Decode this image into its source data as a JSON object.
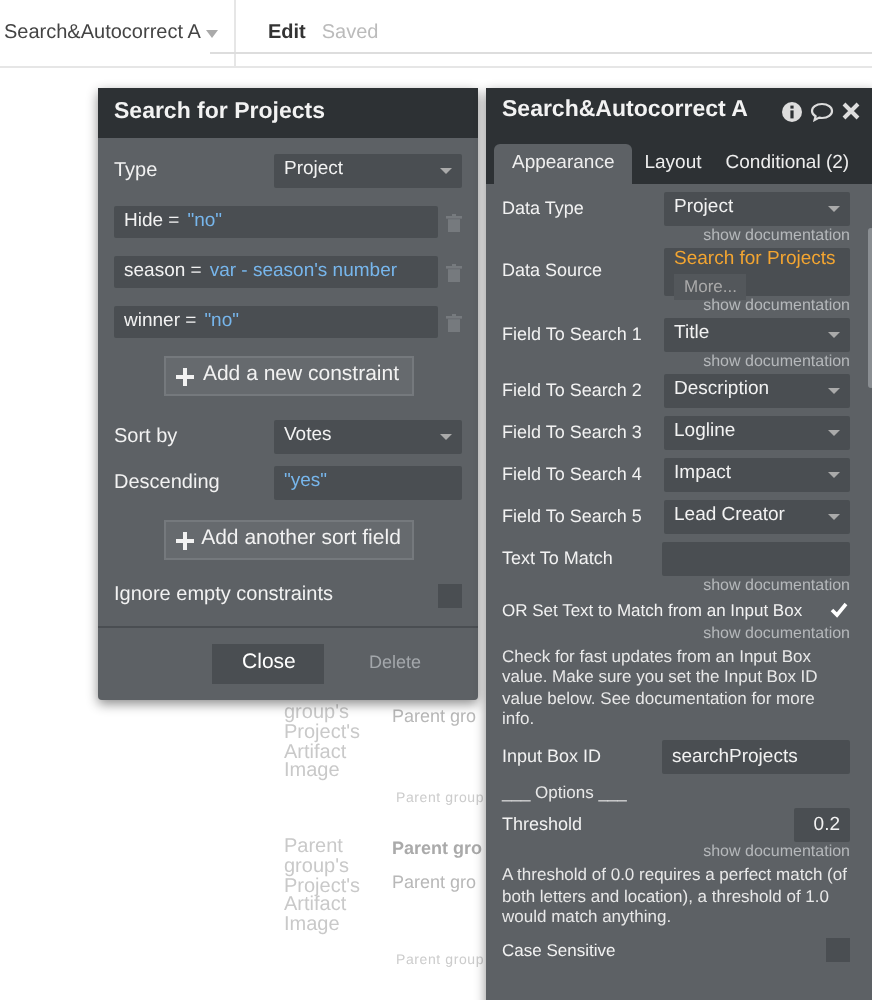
{
  "editor_bar": {
    "element_name": "Search&Autocorrect A",
    "mode": "Edit",
    "status": "Saved"
  },
  "canvas_items": [
    {
      "kind": "image_label",
      "text": "group's Project's Artifact Image"
    },
    {
      "kind": "heading",
      "text": "Parent gro"
    },
    {
      "kind": "small",
      "text": "Parent group"
    },
    {
      "kind": "image_label",
      "text": "Parent group's Project's Artifact Image"
    },
    {
      "kind": "bold",
      "text": "Parent gro"
    },
    {
      "kind": "heading",
      "text": "Parent gro"
    },
    {
      "kind": "small",
      "text": "Parent group"
    }
  ],
  "search_dialog": {
    "title": "Search for Projects",
    "type": {
      "label": "Type",
      "value": "Project"
    },
    "constraints": [
      {
        "field": "Hide =",
        "value": "\"no\""
      },
      {
        "field": "season =",
        "value": "var - season's number"
      },
      {
        "field": "winner =",
        "value": "\"no\""
      }
    ],
    "add_constraint_button": "Add a new constraint",
    "sort_by": {
      "label": "Sort by",
      "value": "Votes"
    },
    "descending": {
      "label": "Descending",
      "value": "\"yes\""
    },
    "add_sort_button": "Add another sort field",
    "ignore_empty": {
      "label": "Ignore empty constraints",
      "checked": false
    },
    "buttons": [
      {
        "label": "Close",
        "disabled": false
      },
      {
        "label": "Delete",
        "disabled": true
      }
    ]
  },
  "property_editor": {
    "title": "Search&Autocorrect A",
    "tabs": [
      {
        "label": "Appearance",
        "selected": true
      },
      {
        "label": "Layout",
        "selected": false
      },
      {
        "label": "Conditional (2)",
        "selected": false
      }
    ],
    "properties": [
      {
        "kind": "select",
        "label": "Data Type",
        "value": "Project",
        "doc": "show documentation"
      },
      {
        "kind": "source",
        "label": "Data Source",
        "value": "Search for Projects",
        "more": "More...",
        "doc": "show documentation"
      },
      {
        "kind": "select",
        "label": "Field To Search 1",
        "value": "Title",
        "doc": "show documentation"
      },
      {
        "kind": "select",
        "label": "Field To Search 2",
        "value": "Description"
      },
      {
        "kind": "select",
        "label": "Field To Search 3",
        "value": "Logline"
      },
      {
        "kind": "select",
        "label": "Field To Search 4",
        "value": "Impact"
      },
      {
        "kind": "select",
        "label": "Field To Search 5",
        "value": "Lead Creator"
      },
      {
        "kind": "input",
        "label": "Text To Match",
        "doc": "show documentation"
      },
      {
        "kind": "checkbox",
        "label": "OR Set Text to Match from an Input Box",
        "checked": true,
        "doc": "show documentation"
      },
      {
        "kind": "note",
        "text": "Check for fast updates from an Input Box value. Make sure you set the Input Box ID value below. See documentation for more info."
      },
      {
        "kind": "input",
        "label": "Input Box ID",
        "value": "searchProjects"
      },
      {
        "kind": "section",
        "text": "___ Options ___"
      },
      {
        "kind": "number",
        "label": "Threshold",
        "value": "0.2",
        "doc": "show documentation"
      },
      {
        "kind": "note",
        "text": "A threshold of 0.0 requires a perfect match (of both letters and location), a threshold of 1.0 would match anything."
      },
      {
        "kind": "checkbox",
        "label": "Case Sensitive",
        "checked": false
      }
    ]
  }
}
